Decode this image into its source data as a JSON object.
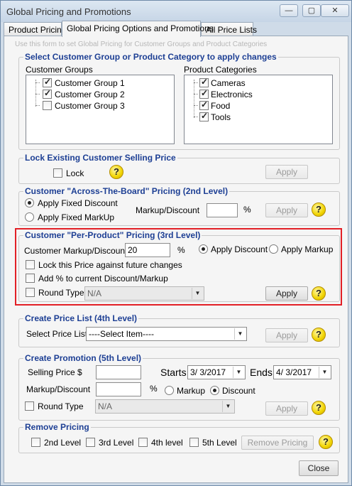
{
  "window": {
    "title": "Global Pricing and Promotions"
  },
  "tabs": [
    "Product Pricing",
    "Global Pricing Options and Promotions",
    "All Price Lists"
  ],
  "hint": "Use this form to set Global Pricing for Customer Groups and Product Categories",
  "select_section": {
    "title": "Select Customer Group or Product Category to apply changes",
    "customer_groups_label": "Customer Groups",
    "customer_groups": [
      {
        "label": "Customer Group 1",
        "checked": true
      },
      {
        "label": "Customer Group 2",
        "checked": true
      },
      {
        "label": "Customer Group 3",
        "checked": false
      }
    ],
    "product_categories_label": "Product Categories",
    "product_categories": [
      {
        "label": "Cameras",
        "checked": true
      },
      {
        "label": "Electronics",
        "checked": true
      },
      {
        "label": "Food",
        "checked": true
      },
      {
        "label": "Tools",
        "checked": true
      }
    ]
  },
  "lock_section": {
    "title": "Lock Existing Customer Selling Price",
    "lock_label": "Lock",
    "apply": "Apply"
  },
  "level2": {
    "title": "Customer \"Across-The-Board\" Pricing (2nd Level)",
    "apply_fixed_discount": "Apply Fixed Discount",
    "apply_fixed_markup": "Apply Fixed MarkUp",
    "markup_discount_label": "Markup/Discount",
    "markup_value": "",
    "percent": "%",
    "apply": "Apply"
  },
  "level3": {
    "title": "Customer \"Per-Product\" Pricing (3rd Level)",
    "markup_label": "Customer Markup/Discount",
    "markup_value": "20",
    "percent": "%",
    "apply_discount": "Apply Discount",
    "apply_markup": "Apply Markup",
    "lock_price": "Lock this Price against future changes",
    "add_percent": "Add % to current Discount/Markup",
    "round_type": "Round Type",
    "round_value": "N/A",
    "apply": "Apply"
  },
  "level4": {
    "title": "Create Price List (4th Level)",
    "select_label": "Select Price List",
    "select_value": "----Select Item----",
    "apply": "Apply"
  },
  "level5": {
    "title": "Create Promotion (5th Level)",
    "selling_price_label": "Selling Price $",
    "starts_label": "Starts",
    "starts_value": "3/ 3/2017",
    "ends_label": "Ends",
    "ends_value": "4/ 3/2017",
    "markup_label": "Markup/Discount",
    "percent": "%",
    "markup": "Markup",
    "discount": "Discount",
    "round_type": "Round Type",
    "round_value": "N/A",
    "apply": "Apply"
  },
  "remove": {
    "title": "Remove Pricing",
    "level2": "2nd Level",
    "level3": "3rd Level",
    "level4": "4th level",
    "level5": "5th Level",
    "button": "Remove Pricing"
  },
  "close": "Close"
}
